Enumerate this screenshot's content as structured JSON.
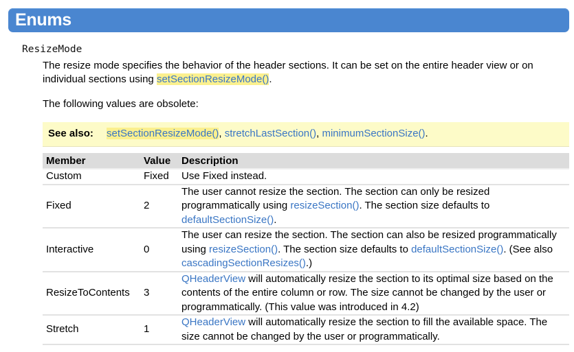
{
  "section": {
    "title": "Enums"
  },
  "enum": {
    "name": "ResizeMode",
    "description_before": "The resize mode specifies the behavior of the header sections. It can be set on the entire header view or on individual sections using ",
    "description_link": "setSectionResizeMode()",
    "description_after": ".",
    "obsolete_note": "The following values are obsolete:"
  },
  "see_also": {
    "label": "See also:",
    "links": [
      "setSectionResizeMode()",
      "stretchLastSection()",
      "minimumSectionSize()"
    ],
    "separator": ", ",
    "end": "."
  },
  "table": {
    "headers": [
      "Member",
      "Value",
      "Description"
    ],
    "rows": [
      {
        "member": "Custom",
        "value": "Fixed",
        "desc_text": "Use Fixed instead."
      },
      {
        "member": "Fixed",
        "value": "2",
        "desc_a": "The user cannot resize the section. The section can only be resized programmatically using ",
        "desc_link1": "resizeSection()",
        "desc_b": ". The section size defaults to ",
        "desc_link2": "defaultSectionSize()",
        "desc_c": "."
      },
      {
        "member": "Interactive",
        "value": "0",
        "desc_a": "The user can resize the section. The section can also be resized programmatically using ",
        "desc_link1": "resizeSection()",
        "desc_b": ". The section size defaults to ",
        "desc_link2": "defaultSectionSize()",
        "desc_c": ". (See also ",
        "desc_link3": "cascadingSectionResizes()",
        "desc_d": ".)"
      },
      {
        "member": "ResizeToContents",
        "value": "3",
        "desc_link1": "QHeaderView",
        "desc_a": " will automatically resize the section to its optimal size based on the contents of the entire column or row. The size cannot be changed by the user or programmatically. (This value was introduced in 4.2)"
      },
      {
        "member": "Stretch",
        "value": "1",
        "desc_link1": "QHeaderView",
        "desc_a": " will automatically resize the section to fill the available space. The size cannot be changed by the user or programmatically."
      }
    ]
  },
  "colors": {
    "header_bar": "#4a86d0",
    "link": "#3a76c4",
    "highlight": "#fbf08e",
    "see_also_bg": "#fdfbc8",
    "table_header_bg": "#dcdcdc"
  }
}
